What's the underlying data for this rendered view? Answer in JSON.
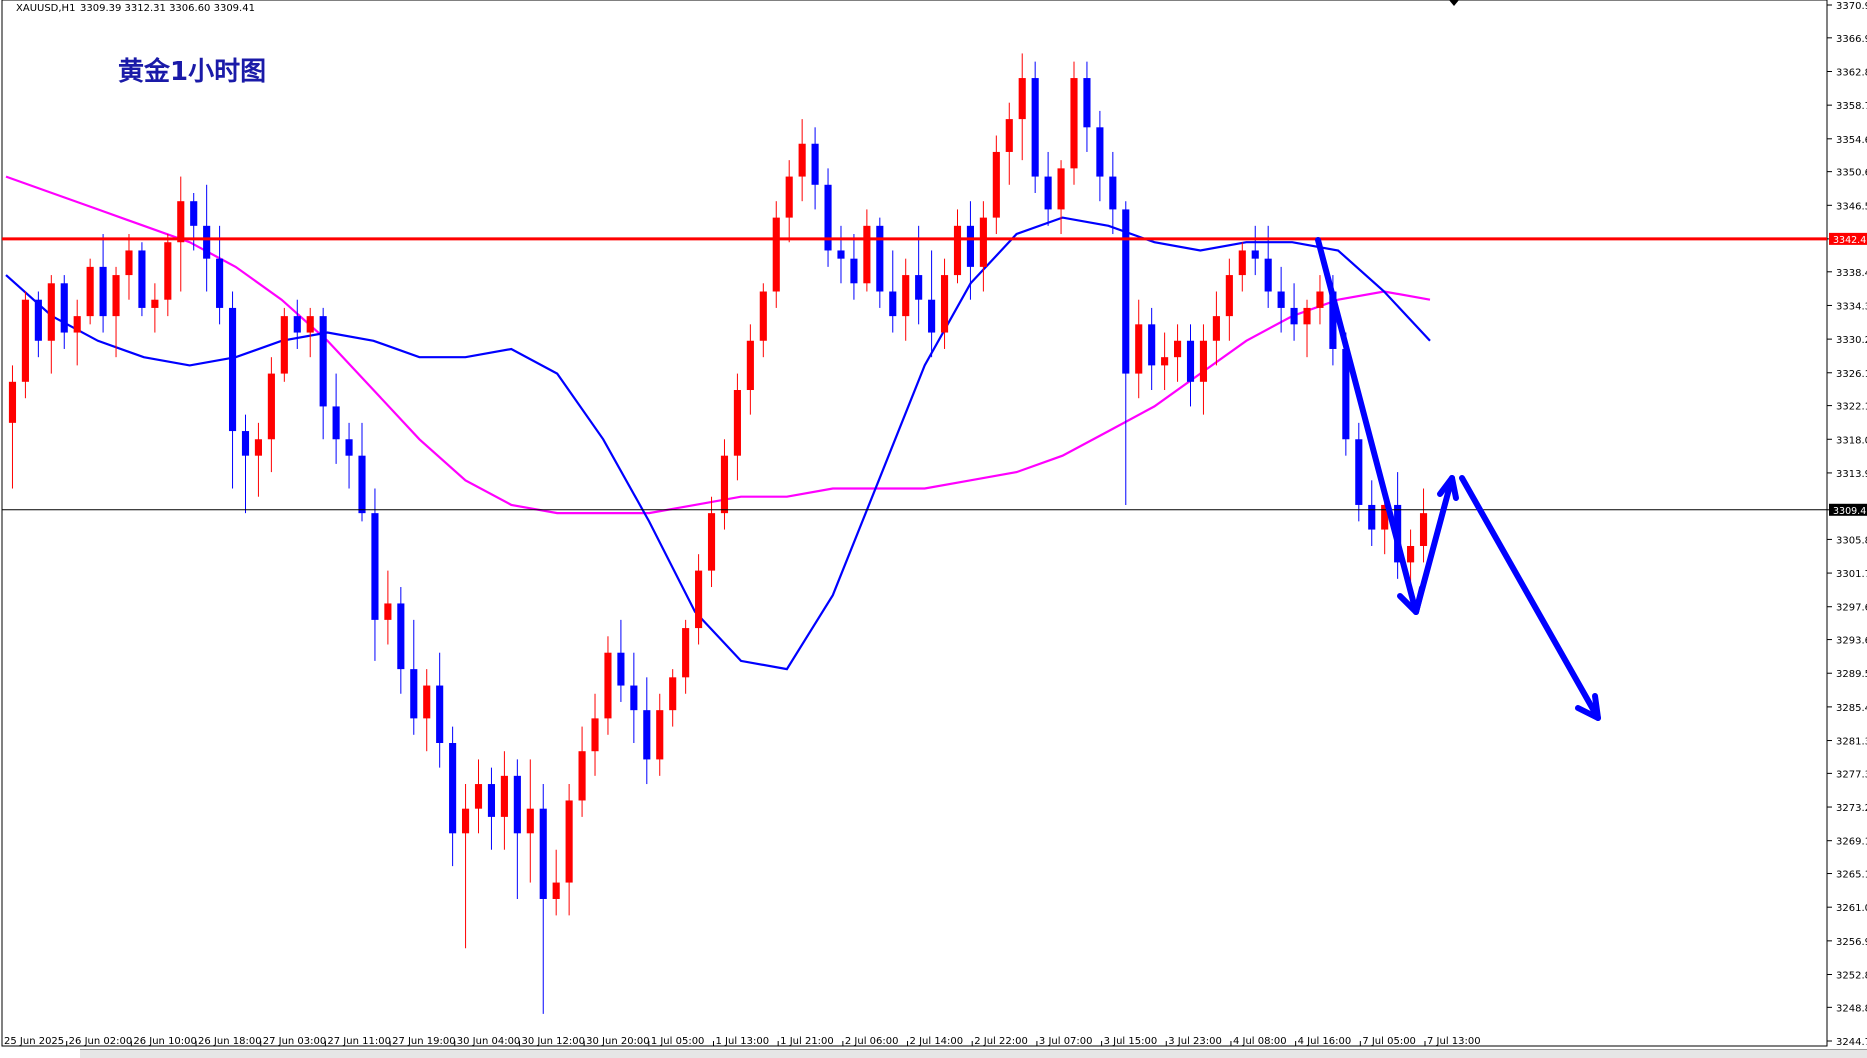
{
  "header": {
    "symbol": "XAUUSD,H1",
    "quote": "3309.39 3312.31 3306.60 3309.41"
  },
  "title": "黄金1小时图",
  "colors": {
    "up": "#ff0000",
    "down": "#0000ff",
    "ma_fast": "#0000ff",
    "ma_slow": "#ff00ff",
    "resistance": "#ff0000",
    "current": "#000000",
    "arrows": "#0000ff"
  },
  "chart_data": {
    "type": "candlestick",
    "ylim": [
      3244.7,
      3370.9
    ],
    "y_ticks": [
      "3370.90",
      "3366.90",
      "3362.80",
      "3358.70",
      "3354.60",
      "3350.60",
      "3346.50",
      "3342.41",
      "3338.40",
      "3334.30",
      "3330.20",
      "3326.10",
      "3322.10",
      "3318.00",
      "3313.90",
      "3309.41",
      "3305.80",
      "3301.70",
      "3297.60",
      "3293.60",
      "3289.50",
      "3285.40",
      "3281.30",
      "3277.30",
      "3273.20",
      "3269.10",
      "3265.10",
      "3261.00",
      "3256.90",
      "3252.80",
      "3248.80",
      "3244.70"
    ],
    "x_ticks": [
      "25 Jun 2025",
      "26 Jun 02:00",
      "26 Jun 10:00",
      "26 Jun 18:00",
      "27 Jun 03:00",
      "27 Jun 11:00",
      "27 Jun 19:00",
      "30 Jun 04:00",
      "30 Jun 12:00",
      "30 Jun 20:00",
      "1 Jul 05:00",
      "1 Jul 13:00",
      "1 Jul 21:00",
      "2 Jul 06:00",
      "2 Jul 14:00",
      "2 Jul 22:00",
      "3 Jul 07:00",
      "3 Jul 15:00",
      "3 Jul 23:00",
      "4 Jul 08:00",
      "4 Jul 16:00",
      "7 Jul 05:00",
      "7 Jul 13:00"
    ],
    "resistance_level": 3342.41,
    "resistance_label": "3342.41",
    "current_price": 3309.41,
    "current_label": "3309.41",
    "ohlc": [
      [
        3320,
        3327,
        3312,
        3325
      ],
      [
        3325,
        3336,
        3323,
        3335
      ],
      [
        3335,
        3336,
        3328,
        3330
      ],
      [
        3330,
        3338,
        3326,
        3337
      ],
      [
        3337,
        3338,
        3329,
        3331
      ],
      [
        3331,
        3335,
        3327,
        3333
      ],
      [
        3333,
        3340,
        3332,
        3339
      ],
      [
        3339,
        3343,
        3331,
        3333
      ],
      [
        3333,
        3339,
        3328,
        3338
      ],
      [
        3338,
        3343,
        3335,
        3341
      ],
      [
        3341,
        3342,
        3333,
        3334
      ],
      [
        3334,
        3337,
        3331,
        3335
      ],
      [
        3335,
        3343,
        3333,
        3342
      ],
      [
        3342,
        3350,
        3336,
        3347
      ],
      [
        3347,
        3348,
        3341,
        3344
      ],
      [
        3344,
        3349,
        3336,
        3340
      ],
      [
        3340,
        3344,
        3332,
        3334
      ],
      [
        3334,
        3336,
        3312,
        3319
      ],
      [
        3319,
        3321,
        3309,
        3316
      ],
      [
        3316,
        3320,
        3311,
        3318
      ],
      [
        3318,
        3328,
        3314,
        3326
      ],
      [
        3326,
        3334,
        3325,
        3333
      ],
      [
        3333,
        3335,
        3329,
        3331
      ],
      [
        3331,
        3334,
        3328,
        3333
      ],
      [
        3333,
        3334,
        3318,
        3322
      ],
      [
        3322,
        3326,
        3315,
        3318
      ],
      [
        3318,
        3320,
        3312,
        3316
      ],
      [
        3316,
        3320,
        3308,
        3309
      ],
      [
        3309,
        3312,
        3291,
        3296
      ],
      [
        3296,
        3302,
        3293,
        3298
      ],
      [
        3298,
        3300,
        3287,
        3290
      ],
      [
        3290,
        3296,
        3282,
        3284
      ],
      [
        3284,
        3290,
        3280,
        3288
      ],
      [
        3288,
        3292,
        3278,
        3281
      ],
      [
        3281,
        3283,
        3266,
        3270
      ],
      [
        3270,
        3276,
        3256,
        3273
      ],
      [
        3273,
        3279,
        3270,
        3276
      ],
      [
        3276,
        3278,
        3268,
        3272
      ],
      [
        3272,
        3280,
        3268,
        3277
      ],
      [
        3277,
        3279,
        3262,
        3270
      ],
      [
        3270,
        3279,
        3264,
        3273
      ],
      [
        3273,
        3276,
        3248,
        3262
      ],
      [
        3262,
        3268,
        3260,
        3264
      ],
      [
        3264,
        3276,
        3260,
        3274
      ],
      [
        3274,
        3283,
        3272,
        3280
      ],
      [
        3280,
        3287,
        3277,
        3284
      ],
      [
        3284,
        3294,
        3282,
        3292
      ],
      [
        3292,
        3296,
        3286,
        3288
      ],
      [
        3288,
        3292,
        3281,
        3285
      ],
      [
        3285,
        3289,
        3276,
        3279
      ],
      [
        3279,
        3287,
        3277,
        3285
      ],
      [
        3285,
        3290,
        3283,
        3289
      ],
      [
        3289,
        3296,
        3287,
        3295
      ],
      [
        3295,
        3304,
        3293,
        3302
      ],
      [
        3302,
        3311,
        3300,
        3309
      ],
      [
        3309,
        3318,
        3307,
        3316
      ],
      [
        3316,
        3326,
        3313,
        3324
      ],
      [
        3324,
        3332,
        3321,
        3330
      ],
      [
        3330,
        3337,
        3328,
        3336
      ],
      [
        3336,
        3347,
        3334,
        3345
      ],
      [
        3345,
        3352,
        3342,
        3350
      ],
      [
        3350,
        3357,
        3347,
        3354
      ],
      [
        3354,
        3356,
        3346,
        3349
      ],
      [
        3349,
        3351,
        3339,
        3341
      ],
      [
        3341,
        3344,
        3337,
        3340
      ],
      [
        3340,
        3343,
        3335,
        3337
      ],
      [
        3337,
        3346,
        3336,
        3344
      ],
      [
        3344,
        3345,
        3334,
        3336
      ],
      [
        3336,
        3341,
        3331,
        3333
      ],
      [
        3333,
        3340,
        3330,
        3338
      ],
      [
        3338,
        3344,
        3332,
        3335
      ],
      [
        3335,
        3341,
        3328,
        3331
      ],
      [
        3331,
        3340,
        3329,
        3338
      ],
      [
        3338,
        3346,
        3337,
        3344
      ],
      [
        3344,
        3347,
        3335,
        3339
      ],
      [
        3339,
        3347,
        3336,
        3345
      ],
      [
        3345,
        3355,
        3343,
        3353
      ],
      [
        3353,
        3359,
        3349,
        3357
      ],
      [
        3357,
        3365,
        3352,
        3362
      ],
      [
        3362,
        3364,
        3348,
        3350
      ],
      [
        3350,
        3353,
        3344,
        3346
      ],
      [
        3346,
        3352,
        3343,
        3351
      ],
      [
        3351,
        3364,
        3349,
        3362
      ],
      [
        3362,
        3364,
        3353,
        3356
      ],
      [
        3356,
        3358,
        3347,
        3350
      ],
      [
        3350,
        3353,
        3343,
        3346
      ],
      [
        3346,
        3347,
        3310,
        3326
      ],
      [
        3326,
        3335,
        3323,
        3332
      ],
      [
        3332,
        3334,
        3324,
        3327
      ],
      [
        3327,
        3331,
        3324,
        3328
      ],
      [
        3328,
        3332,
        3325,
        3330
      ],
      [
        3330,
        3332,
        3322,
        3325
      ],
      [
        3325,
        3332,
        3321,
        3330
      ],
      [
        3330,
        3336,
        3327,
        3333
      ],
      [
        3333,
        3340,
        3330,
        3338
      ],
      [
        3338,
        3342,
        3336,
        3341
      ],
      [
        3341,
        3344,
        3338,
        3340
      ],
      [
        3340,
        3344,
        3334,
        3336
      ],
      [
        3336,
        3339,
        3331,
        3334
      ],
      [
        3334,
        3337,
        3330,
        3332
      ],
      [
        3332,
        3335,
        3328,
        3334
      ],
      [
        3334,
        3338,
        3332,
        3336
      ],
      [
        3336,
        3338,
        3327,
        3329
      ],
      [
        3329,
        3331,
        3316,
        3318
      ],
      [
        3318,
        3320,
        3308,
        3310
      ],
      [
        3310,
        3313,
        3305,
        3307
      ],
      [
        3307,
        3312,
        3304,
        3310
      ],
      [
        3310,
        3314,
        3301,
        3303
      ],
      [
        3303,
        3307,
        3300,
        3305
      ],
      [
        3305,
        3312,
        3303,
        3309
      ]
    ],
    "ma_fast": [
      3338,
      3333,
      3330,
      3328,
      3327,
      3328,
      3330,
      3331,
      3330,
      3328,
      3328,
      3329,
      3326,
      3318,
      3308,
      3297,
      3291,
      3290,
      3299,
      3313,
      3327,
      3337,
      3343,
      3345,
      3344,
      3342,
      3341,
      3342,
      3342,
      3341,
      3336,
      3330
    ],
    "ma_slow": [
      3350,
      3348,
      3346,
      3344,
      3342,
      3339,
      3335,
      3330,
      3324,
      3318,
      3313,
      3310,
      3309,
      3309,
      3309,
      3310,
      3311,
      3311,
      3312,
      3312,
      3312,
      3313,
      3314,
      3316,
      3319,
      3322,
      3326,
      3330,
      3333,
      3335,
      3336,
      3335
    ]
  }
}
